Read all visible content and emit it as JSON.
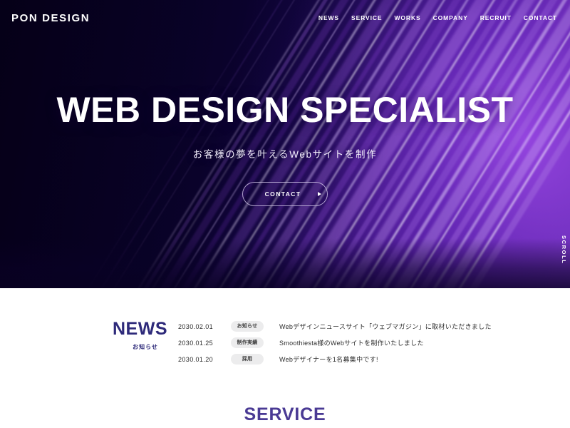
{
  "header": {
    "logo": "PON DESIGN",
    "nav": [
      {
        "label": "NEWS"
      },
      {
        "label": "SERVICE"
      },
      {
        "label": "WORKS"
      },
      {
        "label": "COMPANY"
      },
      {
        "label": "RECRUIT"
      },
      {
        "label": "CONTACT"
      }
    ]
  },
  "hero": {
    "title": "WEB DESIGN SPECIALIST",
    "subtitle": "お客様の夢を叶えるWebサイトを制作",
    "cta_label": "CONTACT",
    "cta_icon": "triangle-right-icon",
    "scroll_label": "SCROLL",
    "colors": {
      "background_dark": "#0b0230",
      "accent_purple": "#7b35c4",
      "accent_bright": "#9a5ae0"
    }
  },
  "news": {
    "heading": "NEWS",
    "heading_sub": "お知らせ",
    "heading_color": "#2e2a7a",
    "items": [
      {
        "date": "2030.02.01",
        "tag": "お知らせ",
        "text": "Webデザインニュースサイト「ウェブマガジン」に取材いただきました"
      },
      {
        "date": "2030.01.25",
        "tag": "制作実績",
        "text": "Smoothiesta様のWebサイトを制作いたしました"
      },
      {
        "date": "2030.01.20",
        "tag": "採用",
        "text": "Webデザイナーを1名募集中です!"
      }
    ]
  },
  "service": {
    "heading": "SERVICE",
    "heading_color": "#4a3a94"
  }
}
